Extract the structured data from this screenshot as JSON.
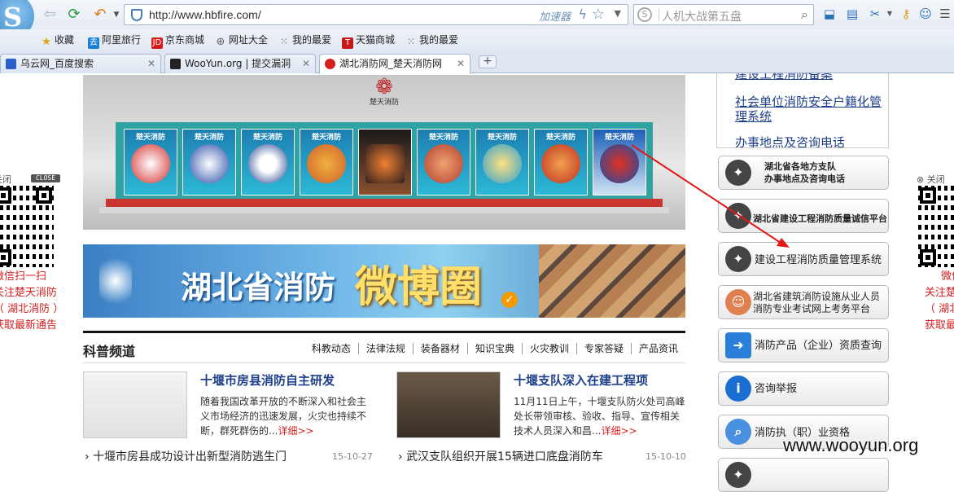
{
  "browser": {
    "url": "http://www.hbfire.com/",
    "accelerator_label": "加速器",
    "search_placeholder": "人机大战第五盘"
  },
  "bookmarks": [
    {
      "label": "收藏",
      "icon": "star-icon"
    },
    {
      "label": "阿里旅行",
      "icon": "alitrip-icon"
    },
    {
      "label": "京东商城",
      "icon": "jd-icon"
    },
    {
      "label": "网址大全",
      "icon": "globe-icon"
    },
    {
      "label": "我的最爱",
      "icon": "grid-icon"
    },
    {
      "label": "天猫商城",
      "icon": "tmall-icon"
    },
    {
      "label": "我的最爱",
      "icon": "grid-icon"
    }
  ],
  "tabs": [
    {
      "label": "乌云网_百度搜索"
    },
    {
      "label": "WooYun.org | 提交漏洞"
    },
    {
      "label": "湖北消防网_楚天消防网"
    }
  ],
  "float_ads": {
    "close_label": "关闭",
    "close_badge": "CLOSE",
    "left_lines": [
      "微信扫一扫",
      "关注楚天消防",
      "（ 湖北消防 ）",
      "获取最新通告"
    ],
    "right_lines": [
      "微信",
      "关注楚",
      "（ 湖北",
      "获取最"
    ]
  },
  "showcase": {
    "brand": "楚天消防",
    "covers": [
      "楚天消防",
      "楚天消防",
      "楚天消防",
      "楚天消防",
      "",
      "楚天消防",
      "楚天消防",
      "楚天消防",
      "楚天消防"
    ]
  },
  "weibo_banner": {
    "title_part1": "湖北省消防",
    "title_part2": "微博圈"
  },
  "science": {
    "heading": "科普频道",
    "links": [
      "科教动态",
      "法律法规",
      "装备器材",
      "知识宝典",
      "火灾教训",
      "专家答疑",
      "产品资讯"
    ]
  },
  "news": [
    {
      "title": "十堰市房县消防自主研发",
      "desc": "随着我国改革开放的不断深入和社会主义市场经济的迅速发展，火灾也持续不断，群死群伤的...",
      "more": "详细>>"
    },
    {
      "title": "十堰支队深入在建工程项",
      "desc": "11月11日上午，十堰支队防火处司高峰处长带领审核、验收、指导、宣传相关技术人员深入和昌...",
      "more": "详细>>"
    }
  ],
  "news_lines": [
    {
      "text": "十堰市房县成功设计出新型消防逃生门",
      "date": "15-10-27"
    },
    {
      "text": "武汉支队组织开展15辆进口底盘消防车",
      "date": "15-10-10"
    }
  ],
  "sidebar": {
    "links": [
      "建设工程消防备案",
      "社会单位消防安全户籍化管理系统",
      "办事地点及咨询电话"
    ],
    "buttons": [
      {
        "line1": "湖北省各地方支队",
        "line2": "办事地点及咨询电话"
      },
      {
        "line1": "湖北省建设工程消防质量诚信平台",
        "line2": ""
      },
      {
        "line1": "建设工程消防质量管理系统",
        "line2": ""
      },
      {
        "line1": "湖北省建筑消防设施从业人员",
        "line2": "消防专业考试网上考务平台"
      },
      {
        "line1": "消防产品（企业）资质查询",
        "line2": ""
      },
      {
        "line1": "咨询举报",
        "line2": ""
      },
      {
        "line1": "消防执（职）业资格",
        "line2": ""
      }
    ]
  },
  "watermark": "www.wooyun.org"
}
